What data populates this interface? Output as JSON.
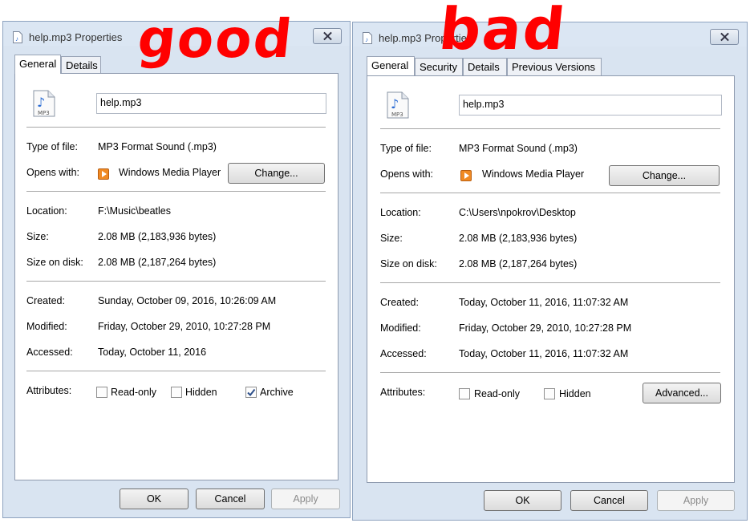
{
  "left": {
    "title": "help.mp3 Properties",
    "tabs": [
      "General",
      "Details"
    ],
    "filename": "help.mp3",
    "type_label": "Type of file:",
    "type_value": "MP3 Format Sound (.mp3)",
    "opens_label": "Opens with:",
    "opens_value": "Windows Media Player",
    "change_label": "Change...",
    "location_label": "Location:",
    "location_value": "F:\\Music\\beatles",
    "size_label": "Size:",
    "size_value": "2.08 MB (2,183,936 bytes)",
    "disk_label": "Size on disk:",
    "disk_value": "2.08 MB (2,187,264 bytes)",
    "created_label": "Created:",
    "created_value": "Sunday, October 09, 2016, 10:26:09 AM",
    "modified_label": "Modified:",
    "modified_value": "Friday, October 29, 2010, 10:27:28 PM",
    "accessed_label": "Accessed:",
    "accessed_value": "Today, October 11, 2016",
    "attributes_label": "Attributes:",
    "readonly_label": "Read-only",
    "hidden_label": "Hidden",
    "archive_label": "Archive",
    "readonly_checked": false,
    "hidden_checked": false,
    "archive_checked": true,
    "ok_label": "OK",
    "cancel_label": "Cancel",
    "apply_label": "Apply",
    "annotation": "good"
  },
  "right": {
    "title": "help.mp3 Properties",
    "tabs": [
      "General",
      "Security",
      "Details",
      "Previous Versions"
    ],
    "filename": "help.mp3",
    "type_label": "Type of file:",
    "type_value": "MP3 Format Sound (.mp3)",
    "opens_label": "Opens with:",
    "opens_value": "Windows Media Player",
    "change_label": "Change...",
    "location_label": "Location:",
    "location_value": "C:\\Users\\npokrov\\Desktop",
    "size_label": "Size:",
    "size_value": "2.08 MB (2,183,936 bytes)",
    "disk_label": "Size on disk:",
    "disk_value": "2.08 MB (2,187,264 bytes)",
    "created_label": "Created:",
    "created_value": "Today, October 11, 2016, 11:07:32 AM",
    "modified_label": "Modified:",
    "modified_value": "Friday, October 29, 2010, 10:27:28 PM",
    "accessed_label": "Accessed:",
    "accessed_value": "Today, October 11, 2016, 11:07:32 AM",
    "attributes_label": "Attributes:",
    "readonly_label": "Read-only",
    "hidden_label": "Hidden",
    "readonly_checked": false,
    "hidden_checked": false,
    "advanced_label": "Advanced...",
    "ok_label": "OK",
    "cancel_label": "Cancel",
    "apply_label": "Apply",
    "annotation": "bad"
  },
  "colors": {
    "annotation": "#ff0000",
    "window_frame": "#d9e4f1"
  },
  "icons": [
    "mp3-file-icon",
    "media-player-icon",
    "close-icon",
    "checkmark-icon"
  ]
}
